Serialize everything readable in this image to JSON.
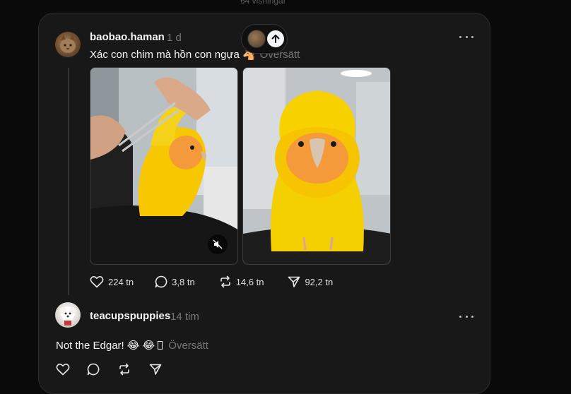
{
  "top_hint": "64 visningar",
  "post": {
    "username": "baobao.haman",
    "time": "1 d",
    "text": "Xác con chim mà hồn con ngựa 🐴",
    "translate": "Översätt",
    "likes": "224 tn",
    "replies": "3,8 tn",
    "reposts": "14,6 tn",
    "shares": "92,2 tn"
  },
  "reply": {
    "username": "teacupspuppies",
    "time": "14 tim",
    "text": "Not the Edgar! 😂 😂 ",
    "translate": "Översätt"
  },
  "colors": {
    "background": "#0a0a0a",
    "card": "#181818",
    "text": "#f3f5f7",
    "muted": "#777777",
    "bird_yellow": "#f7c800",
    "bird_face_orange": "#f59a3a"
  }
}
